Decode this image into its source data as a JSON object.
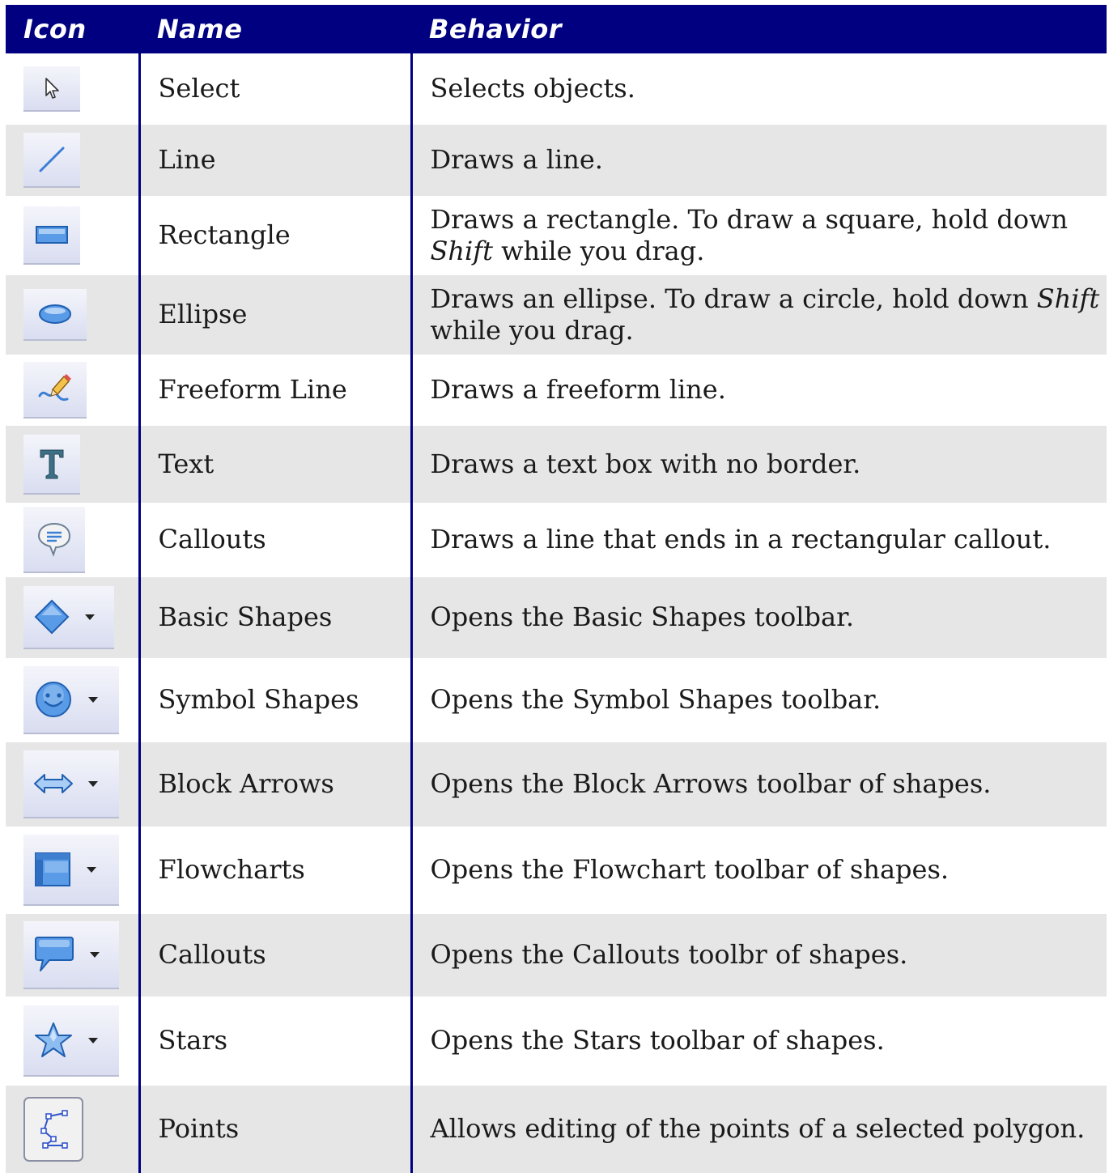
{
  "header": {
    "icon": "Icon",
    "name": "Name",
    "behavior": "Behavior"
  },
  "rows": [
    {
      "icon": "select-arrow-icon",
      "name": "Select",
      "behavior": "Selects objects."
    },
    {
      "icon": "line-icon",
      "name": "Line",
      "behavior": "Draws a line."
    },
    {
      "icon": "rectangle-icon",
      "name": "Rectangle",
      "behavior_pre": "Draws a rectangle. To draw a square, hold down ",
      "behavior_em": "Shift",
      "behavior_post": " while you drag."
    },
    {
      "icon": "ellipse-icon",
      "name": "Ellipse",
      "behavior_pre": "Draws an ellipse. To draw a circle, hold down ",
      "behavior_em": "Shift",
      "behavior_post": " while you drag."
    },
    {
      "icon": "pencil-icon",
      "name": "Freeform Line",
      "behavior": "Draws a freeform line."
    },
    {
      "icon": "text-t-icon",
      "name": "Text",
      "behavior": "Draws a text box with no border."
    },
    {
      "icon": "speech-bubble-icon",
      "name": "Callouts",
      "behavior": "Draws a line that ends in a rectangular callout."
    },
    {
      "icon": "diamond-icon",
      "name": "Basic Shapes",
      "behavior": "Opens the Basic Shapes toolbar."
    },
    {
      "icon": "smiley-icon",
      "name": "Symbol Shapes",
      "behavior": "Opens the Symbol Shapes toolbar."
    },
    {
      "icon": "double-arrow-icon",
      "name": "Block Arrows",
      "behavior": "Opens the Block Arrows toolbar of shapes."
    },
    {
      "icon": "flowchart-icon",
      "name": "Flowcharts",
      "behavior": "Opens the Flowchart toolbar of shapes."
    },
    {
      "icon": "callout-bubble-icon",
      "name": "Callouts",
      "behavior": "Opens the Callouts toolbr of shapes."
    },
    {
      "icon": "star-icon",
      "name": "Stars",
      "behavior": "Opens the Stars toolbar of shapes."
    },
    {
      "icon": "points-icon",
      "name": "Points",
      "behavior": "Allows editing of the points of a selected polygon."
    }
  ],
  "colors": {
    "header_bg": "#000080",
    "header_text": "#ffffff",
    "alt_row": "#e6e6e6",
    "icon_blue": "#3a7fd5"
  }
}
